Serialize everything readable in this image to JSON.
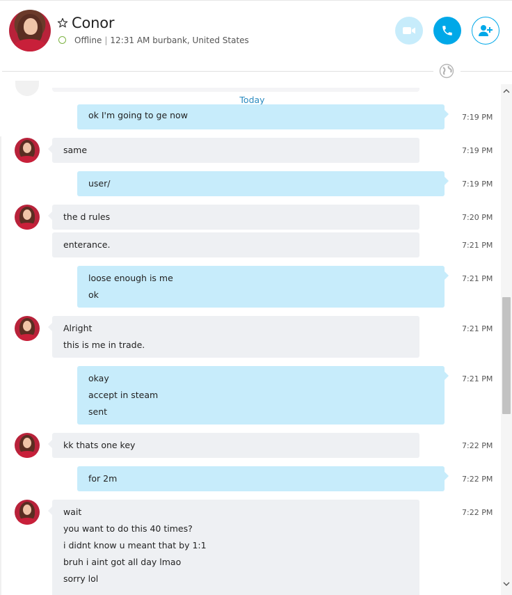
{
  "contact": {
    "name": "Conor",
    "presence": "Offline",
    "local_time": "12:31 AM",
    "location": "burbank, United States",
    "presence_color": "#7cb342"
  },
  "header_actions": [
    {
      "name": "video-call-button",
      "icon": "video-camera-icon"
    },
    {
      "name": "audio-call-button",
      "icon": "phone-icon"
    },
    {
      "name": "add-people-button",
      "icon": "add-person-icon"
    }
  ],
  "colors": {
    "accent": "#00a8e8",
    "outgoing_bubble": "#c7ecfb",
    "incoming_bubble": "#eef0f3",
    "day_label": "#2a8bc0"
  },
  "day_separator": "Today",
  "messages": [
    {
      "dir": "out",
      "lines": [
        "ok I'm going to ge now"
      ],
      "time": "7:19 PM"
    },
    {
      "dir": "in",
      "lines": [
        "same"
      ],
      "time": "7:19 PM"
    },
    {
      "dir": "out",
      "lines": [
        "user/"
      ],
      "time": "7:19 PM"
    },
    {
      "dir": "in",
      "lines": [
        "the d rules"
      ],
      "time": "7:20 PM"
    },
    {
      "dir": "in",
      "lines": [
        "enterance."
      ],
      "time": "7:21 PM"
    },
    {
      "dir": "out",
      "lines": [
        "loose enough is me",
        "ok"
      ],
      "time": "7:21 PM"
    },
    {
      "dir": "in",
      "lines": [
        "Alright",
        "this is me in trade."
      ],
      "time": "7:21 PM"
    },
    {
      "dir": "out",
      "lines": [
        "okay",
        "accept in steam",
        "sent"
      ],
      "time": "7:21 PM"
    },
    {
      "dir": "in",
      "lines": [
        "kk thats one key"
      ],
      "time": "7:22 PM"
    },
    {
      "dir": "out",
      "lines": [
        "for 2m"
      ],
      "time": "7:22 PM"
    },
    {
      "dir": "in",
      "lines": [
        "wait",
        "you want to do this 40 times?",
        "i didnt know u meant that by 1:1",
        "bruh i aint got all day lmao",
        "sorry lol"
      ],
      "time": "7:22 PM"
    }
  ]
}
